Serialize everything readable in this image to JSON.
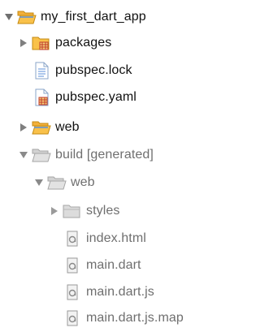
{
  "tree": {
    "root": {
      "label": "my_first_dart_app",
      "expanded": true,
      "icon": "folder-open-icon"
    },
    "packages": {
      "label": "packages",
      "expanded": false,
      "icon": "package-folder-icon"
    },
    "pubspec_lock": {
      "label": "pubspec.lock",
      "icon": "document-icon"
    },
    "pubspec_yaml": {
      "label": "pubspec.yaml",
      "icon": "package-file-icon"
    },
    "web": {
      "label": "web",
      "expanded": false,
      "icon": "folder-closed-icon"
    },
    "build": {
      "label": "build [generated]",
      "expanded": true,
      "icon": "folder-open-icon",
      "derived": true
    },
    "build_web": {
      "label": "web",
      "expanded": true,
      "icon": "folder-open-icon",
      "derived": true
    },
    "styles": {
      "label": "styles",
      "expanded": false,
      "icon": "folder-closed-icon",
      "derived": true
    },
    "index_html": {
      "label": "index.html",
      "icon": "file-icon",
      "derived": true
    },
    "main_dart": {
      "label": "main.dart",
      "icon": "file-icon",
      "derived": true
    },
    "main_dart_js": {
      "label": "main.dart.js",
      "icon": "file-icon",
      "derived": true
    },
    "main_dart_js_map": {
      "label": "main.dart.js.map",
      "icon": "file-icon",
      "derived": true
    }
  },
  "colors": {
    "folder_fill": "#f9c14a",
    "folder_stroke": "#c48a12",
    "derived_fill": "#dcdcdc",
    "derived_stroke": "#a6a6a6",
    "twisty": "#7f7f7f",
    "package_grid": "#c0392b",
    "doc_blue": "#5b8fd8"
  }
}
